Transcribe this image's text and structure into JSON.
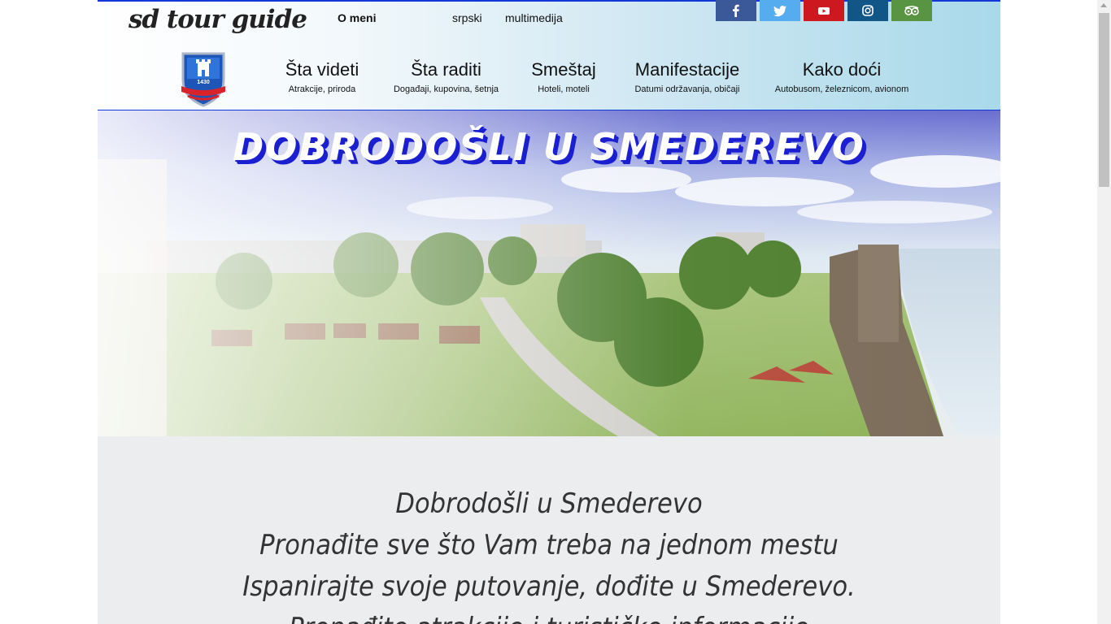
{
  "header": {
    "logo": "sd tour guide",
    "top_links": [
      "O meni",
      "srpski",
      "multimedija"
    ],
    "crest_year": "1430",
    "socials": [
      {
        "name": "facebook",
        "label": "f",
        "color": "#3b5998"
      },
      {
        "name": "twitter",
        "label": "t",
        "color": "#55acee"
      },
      {
        "name": "youtube",
        "label": "▶",
        "color": "#cc181e"
      },
      {
        "name": "instagram",
        "label": "◎",
        "color": "#125688"
      },
      {
        "name": "tripadvisor",
        "label": "∞",
        "color": "#589442"
      }
    ],
    "nav": [
      {
        "title": "Šta videti",
        "subtitle": "Atrakcije, priroda"
      },
      {
        "title": "Šta raditi",
        "subtitle": "Događaji, kupovina, šetnja"
      },
      {
        "title": "Smeštaj",
        "subtitle": "Hoteli, moteli"
      },
      {
        "title": "Manifestacije",
        "subtitle": "Datumi održavanja, običaji"
      },
      {
        "title": "Kako doći",
        "subtitle": "Autobusom, železnicom, avionom"
      }
    ]
  },
  "hero": {
    "title": "DOBRODOŠLI U SMEDEREVO"
  },
  "intro": {
    "lines": [
      "Dobrodošli u Smederevo",
      "Pronađite sve što Vam treba na jednom mestu",
      "Ispanirajte svoje putovanje, dođite u Smederevo.",
      "Pronađite atrakcije i turističke informacije"
    ]
  },
  "colors": {
    "accent_border": "#1238d8",
    "title_shadow": "#1a1fd0"
  }
}
